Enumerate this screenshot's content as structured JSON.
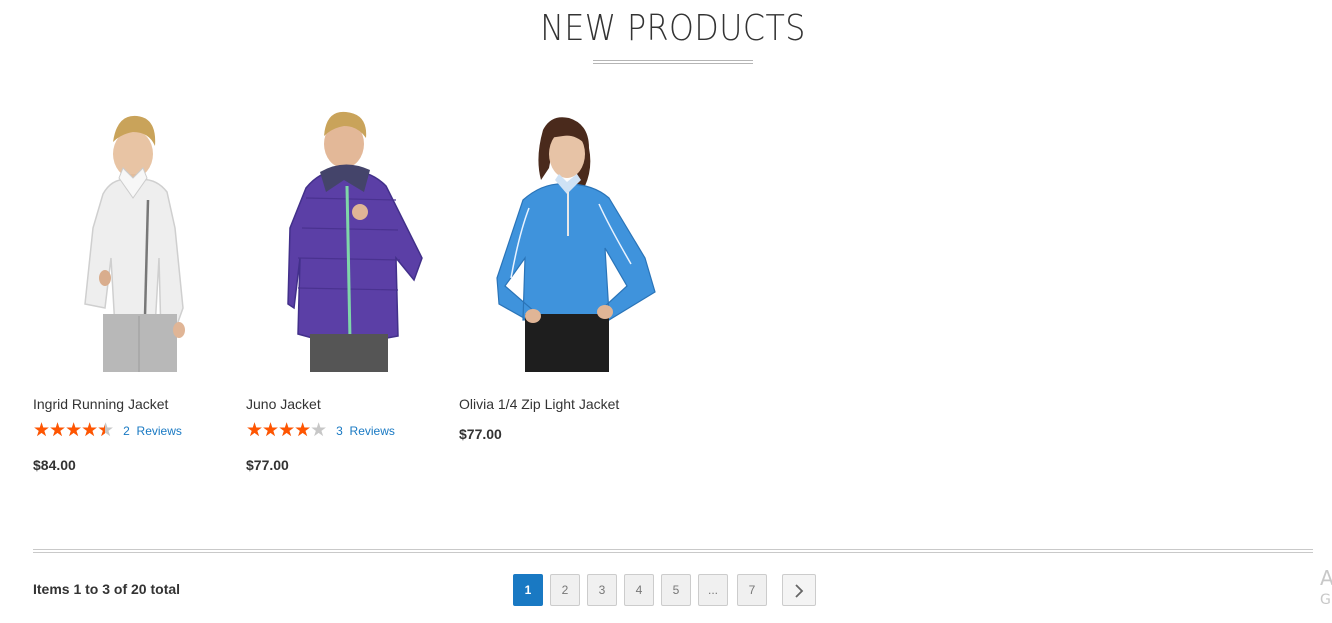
{
  "section": {
    "title": "NEW PRODUCTS"
  },
  "products": [
    {
      "name": "Ingrid Running Jacket",
      "rating": 0.9,
      "rating_stars": "★★★★★",
      "reviews_count": "2",
      "reviews_label": "Reviews",
      "price": "$84.00",
      "image": "woman-white-jacket",
      "color": "#eeeeee"
    },
    {
      "name": "Juno Jacket",
      "rating": 0.8,
      "rating_stars": "★★★★★",
      "reviews_count": "3",
      "reviews_label": "Reviews",
      "price": "$77.00",
      "image": "woman-purple-jacket",
      "color": "#5b3fa6"
    },
    {
      "name": "Olivia 1/4 Zip Light Jacket",
      "price": "$77.00",
      "image": "woman-blue-zip-jacket",
      "color": "#3f93dc"
    }
  ],
  "toolbar": {
    "amount": "Items 1 to 3 of 20 total"
  },
  "pager": {
    "pages": [
      "1",
      "2",
      "3",
      "4",
      "5",
      "...",
      "7"
    ],
    "current": "1",
    "next_icon": "chevron-right-icon"
  },
  "edge_text": {
    "top": "A",
    "bottom": "G"
  },
  "colors": {
    "accent": "#1979c3",
    "star": "#ff5501",
    "star_empty": "#c7c7c7",
    "text": "#333333"
  }
}
